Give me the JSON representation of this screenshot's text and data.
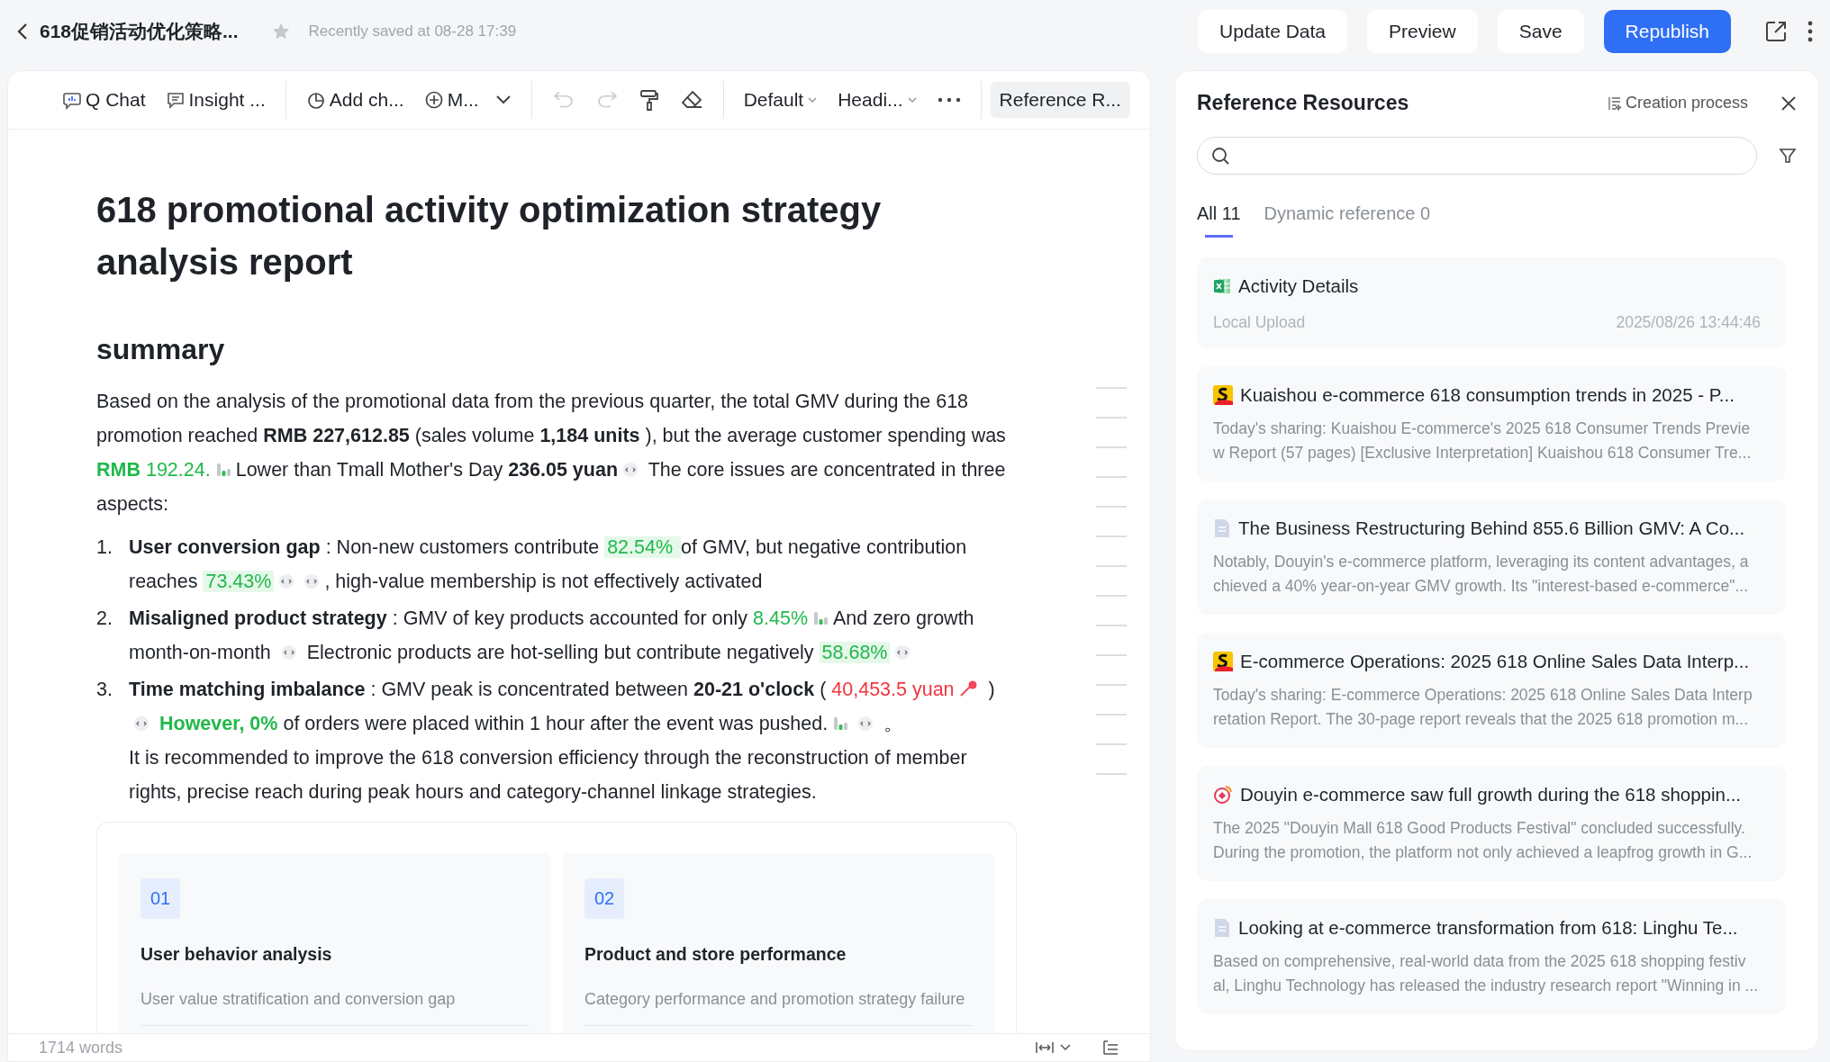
{
  "header": {
    "title": "618促销活动优化策略...",
    "starred": false,
    "saved_text": "Recently saved at 08-28 17:39",
    "buttons": [
      {
        "label": "Update Data",
        "kind": "plain"
      },
      {
        "label": "Preview",
        "kind": "plain"
      },
      {
        "label": "Save",
        "kind": "plain"
      },
      {
        "label": "Republish",
        "kind": "primary"
      }
    ]
  },
  "toolbar": [
    {
      "kind": "chat",
      "label": "Q Chat"
    },
    {
      "kind": "insight",
      "label": "Insight ..."
    },
    {
      "kind": "divider"
    },
    {
      "kind": "chart",
      "label": "Add ch..."
    },
    {
      "kind": "add",
      "label": "M..."
    },
    {
      "kind": "divider"
    },
    {
      "kind": "undo",
      "disabled": true
    },
    {
      "kind": "redo",
      "disabled": true
    },
    {
      "kind": "painter",
      "disabled": false
    },
    {
      "kind": "eraser",
      "disabled": false
    },
    {
      "kind": "divider"
    },
    {
      "kind": "dropdown",
      "label": "Default"
    },
    {
      "kind": "dropdown",
      "label": "Headi..."
    },
    {
      "kind": "ellipsis"
    },
    {
      "kind": "divider"
    },
    {
      "kind": "toggle",
      "label": "Reference R...",
      "selected": true
    }
  ],
  "document": {
    "title": "618 promotional activity optimization strategy analysis report",
    "heading": "summary",
    "intro": [
      {
        "kind": "text",
        "text": "Based on the analysis of the promotional data from the previous quarter, the total GMV during the 618 promotion reached "
      },
      {
        "kind": "bold",
        "text": "RMB 227,612.85"
      },
      {
        "kind": "text",
        "text": " (sales volume "
      },
      {
        "kind": "bold",
        "text": "1,184 units"
      },
      {
        "kind": "text",
        "text": " ), but the average customer spending was "
      },
      {
        "kind": "green",
        "text": "**RMB** 192.24."
      },
      {
        "kind": "chart"
      },
      {
        "kind": "text",
        "text": "Lower than Tmall Mother's Day "
      },
      {
        "kind": "bold",
        "text": "236.05 yuan"
      },
      {
        "kind": "ref"
      },
      {
        "kind": "text",
        "text": " The core issues are concentrated in three aspects:"
      }
    ],
    "items": [
      {
        "number": "1.",
        "segments": [
          {
            "kind": "bold",
            "text": "User conversion gap"
          },
          {
            "kind": "text",
            "text": " : Non-new customers contribute "
          },
          {
            "kind": "metric",
            "text": "82.54% "
          },
          {
            "kind": "text",
            "text": " of GMV, but negative contribution reaches "
          },
          {
            "kind": "metric",
            "text": "73.43%"
          },
          {
            "kind": "ref"
          },
          {
            "kind": "ref"
          },
          {
            "kind": "text",
            "text": ", high-value membership is not effectively activated"
          }
        ]
      },
      {
        "number": "2.",
        "segments": [
          {
            "kind": "bold",
            "text": "Misaligned product strategy"
          },
          {
            "kind": "text",
            "text": " : GMV of key products accounted for only "
          },
          {
            "kind": "green",
            "text": "8.45%"
          },
          {
            "kind": "chart"
          },
          {
            "kind": "text",
            "text": "And zero growth month-on-month "
          },
          {
            "kind": "ref"
          },
          {
            "kind": "text",
            "text": " Electronic products are hot-selling but contribute negatively "
          },
          {
            "kind": "metric",
            "text": "58.68%"
          },
          {
            "kind": "ref"
          }
        ]
      },
      {
        "number": "3.",
        "segments": [
          {
            "kind": "bold",
            "text": "Time matching imbalance"
          },
          {
            "kind": "text",
            "text": " : GMV peak is concentrated between "
          },
          {
            "kind": "bold",
            "text": "20-21 o'clock"
          },
          {
            "kind": "text",
            "text": " ( "
          },
          {
            "kind": "red",
            "text": "40,453.5 yuan"
          },
          {
            "kind": "pin"
          },
          {
            "kind": "text",
            "text": " ) "
          },
          {
            "kind": "ref"
          },
          {
            "kind": "green",
            "text": " **However, 0%**"
          },
          {
            "kind": "text",
            "text": " of orders were placed within 1 hour after the event was pushed."
          },
          {
            "kind": "chart"
          },
          {
            "kind": "ref"
          },
          {
            "kind": "text",
            "text": " 。"
          }
        ],
        "note": "It is recommended to improve the 618 conversion efficiency through the reconstruction of member rights, precise reach during peak hours and category-channel linkage strategies."
      }
    ],
    "cards": [
      {
        "number": "01",
        "title": "User behavior analysis",
        "subtitle": "User value stratification and conversion gap"
      },
      {
        "number": "02",
        "title": "Product and store performance",
        "subtitle": "Category performance and promotion strategy failure"
      }
    ],
    "word_count": "1714 words"
  },
  "panel": {
    "title": "Reference Resources",
    "process_link": "Creation process",
    "tabs": [
      {
        "label": "All 11",
        "selected": true
      },
      {
        "label": "Dynamic reference 0",
        "selected": false
      }
    ],
    "references": [
      {
        "kind": "excel",
        "title": "Activity Details",
        "origin": "Local Upload",
        "date": "2025/08/26 13:44:46"
      },
      {
        "kind": "kuaishou",
        "title": "Kuaishou e-commerce 618 consumption trends in 2025 - P...",
        "summary": [
          "Today's sharing: Kuaishou E-commerce's 2025 618 Consumer Trends Previe",
          "w Report (57 pages) [Exclusive Interpretation] Kuaishou 618 Consumer Tre..."
        ]
      },
      {
        "kind": "doc",
        "title": "The Business Restructuring Behind 855.6 Billion GMV: A Co...",
        "summary": [
          "Notably, Douyin's e-commerce platform, leveraging its content advantages, a",
          "chieved a 40% year-on-year GMV growth. Its \"interest-based e-commerce\"..."
        ]
      },
      {
        "kind": "kuaishou",
        "title": "E-commerce Operations: 2025 618 Online Sales Data Interp...",
        "summary": [
          "Today's sharing: E-commerce Operations: 2025 618 Online Sales Data Interp",
          "retation Report. The 30-page report reveals that the 2025 618 promotion m..."
        ]
      },
      {
        "kind": "douyin",
        "title": "Douyin e-commerce saw full growth during the 618 shoppin...",
        "summary": [
          "The 2025 \"Douyin Mall 618 Good Products Festival\" concluded successfully.",
          "During the promotion, the platform not only achieved a leapfrog growth in G..."
        ]
      },
      {
        "kind": "doc",
        "title": "Looking at e-commerce transformation from 618: Linghu Te...",
        "summary": [
          "Based on comprehensive, real-world data from the 2025 618 shopping festiv",
          "al, Linghu Technology has released the industry research report \"Winning in ..."
        ]
      }
    ]
  }
}
